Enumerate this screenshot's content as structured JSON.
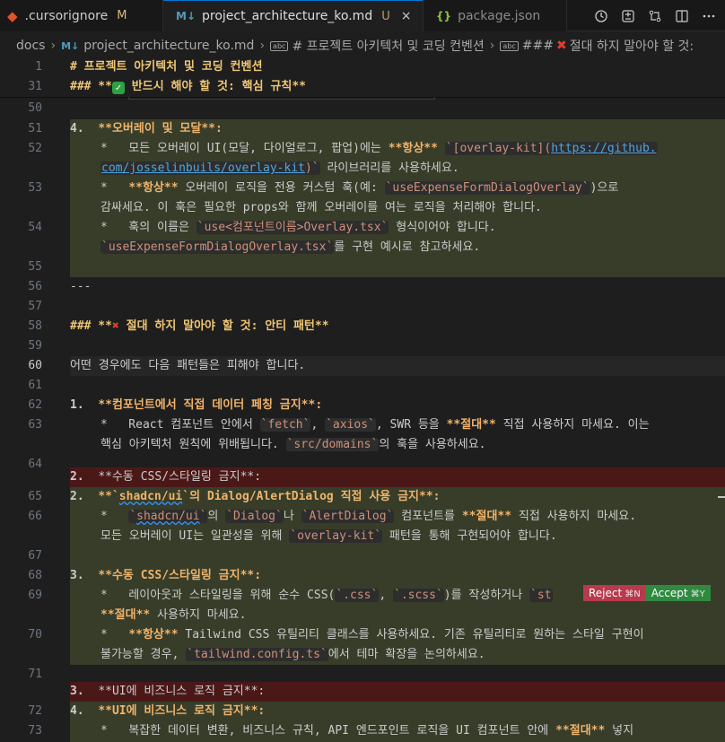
{
  "tabs": [
    {
      "label": ".cursorignore",
      "mark": "M",
      "icon": "git-icon"
    },
    {
      "label": "project_architecture_ko.md",
      "mark": "U",
      "icon": "markdown-icon",
      "close": "×"
    },
    {
      "label": "package.json",
      "icon": "json-icon"
    }
  ],
  "tab_icons": {
    "md": "M↓",
    "json": "{}",
    "git": "◆"
  },
  "breadcrumb": {
    "folder": "docs",
    "file": "project_architecture_ko.md",
    "section1": "# 프로젝트 아키텍처 및 코딩 컨벤션",
    "section2_prefix": "###",
    "section2_text": "절대 하지 말아야 할 것:",
    "abc": "abc"
  },
  "diff_buttons": {
    "reject": "Reject",
    "reject_kbd": "⌘N",
    "accept": "Accept",
    "accept_kbd": "⌘Y"
  },
  "colors": {
    "added_bg": "#373d29",
    "removed_bg": "#4b1818",
    "accent": "#0078d4"
  },
  "lines": {
    "l1": {
      "n": "1",
      "text": "# 프로젝트 아키텍처 및 코딩 컨벤션"
    },
    "l31": {
      "n": "31",
      "pre": "### **",
      "post": " 반드시 해야 할 것: 핵심 규칙**"
    },
    "l50": {
      "n": "50"
    },
    "l51": {
      "n": "51",
      "num": "4.",
      "text": "**오버레이 및 모달**:"
    },
    "l52": {
      "n": "52",
      "a": "*   모든 오버레이 UI(모달, 다이얼로그, 팝업)에는 ",
      "b": "**항상**",
      "c": "[overlay-kit](",
      "link1": "https://github.",
      "link2": "com/josselinbuils/overlay-kit",
      "d": ")`",
      "e": " 라이브러리를 사용하세요."
    },
    "l53": {
      "n": "53",
      "a": "*   ",
      "b": "**항상**",
      "c": " 오버레이 로직을 전용 커스텀 훅(예: ",
      "d": "`useExpenseFormDialogOverlay`",
      "e": ")으로",
      "f": "감싸세요. 이 훅은 필요한 props와 함께 오버레이를 여는 로직을 처리해야 합니다."
    },
    "l54": {
      "n": "54",
      "a": "*   훅의 이름은 ",
      "b": "`use<컴포넌트이름>Overlay.tsx`",
      "c": " 형식이어야 합니다.",
      "d": "`useExpenseFormDialogOverlay.tsx`",
      "e": "를 구현 예시로 참고하세요."
    },
    "l55": {
      "n": "55"
    },
    "l56": {
      "n": "56",
      "text": "---"
    },
    "l57": {
      "n": "57"
    },
    "l58": {
      "n": "58",
      "pre": "### **",
      "post": " 절대 하지 말아야 할 것: 안티 패턴**"
    },
    "l59": {
      "n": "59"
    },
    "l60": {
      "n": "60",
      "text": "어떤 경우에도 다음 패턴들은 피해야 합니다."
    },
    "l61": {
      "n": "61"
    },
    "l62": {
      "n": "62",
      "num": "1.",
      "text": "**컴포넌트에서 직접 데이터 페칭 금지**:"
    },
    "l63": {
      "n": "63",
      "a": "*   React 컴포넌트 안에서 ",
      "b": "`fetch`",
      "c": ", ",
      "d": "`axios`",
      "e": ", SWR 등을 ",
      "f": "**절대**",
      "g": " 직접 사용하지 마세요. 이는",
      "h": "핵심 아키텍처 원칙에 위배됩니다. ",
      "i": "`src/domains`",
      "j": "의 훅을 사용하세요."
    },
    "l64": {
      "n": "64"
    },
    "del2": {
      "num": "2.",
      "text": "**수동 CSS/스타일링 금지**:"
    },
    "l65": {
      "n": "65",
      "num": "2.",
      "a": "**`",
      "b": "shadcn/ui",
      "c": "`의 Dialog/AlertDialog 직접 사용 금지**:"
    },
    "l66": {
      "n": "66",
      "a": "*   ",
      "b": "`",
      "c": "shadcn/ui",
      "d": "`",
      "e": "의 ",
      "f": "`Dialog`",
      "g": "나 ",
      "h": "`AlertDialog`",
      "i": " 컴포넌트를 ",
      "j": "**절대**",
      "k": " 직접 사용하지 마세요.",
      "l": "모든 오버레이 UI는 일관성을 위해 ",
      "m": "`overlay-kit`",
      "n2": " 패턴을 통해 구현되어야 합니다."
    },
    "l67": {
      "n": "67"
    },
    "l68": {
      "n": "68",
      "num": "3.",
      "text": "**수동 CSS/스타일링 금지**:"
    },
    "l69": {
      "n": "69",
      "a": "*   레이아웃과 스타일링을 위해 순수 CSS(",
      "b": "`.css`",
      "c": ", ",
      "d": "`.scss`",
      "e": ")를 작성하거나 ",
      "f": "`st",
      "g": "**절대**",
      "h": " 사용하지 마세요."
    },
    "l70": {
      "n": "70",
      "a": "*   ",
      "b": "**항상**",
      "c": " Tailwind CSS 유틸리티 클래스를 사용하세요. 기존 유틸리티로 원하는 스타일 구현이",
      "d": "불가능할 경우, ",
      "e": "`tailwind.config.ts`",
      "f": "에서 테마 확장을 논의하세요."
    },
    "l71": {
      "n": "71"
    },
    "del3": {
      "num": "3.",
      "text": "**UI에 비즈니스 로직 금지**:"
    },
    "l72": {
      "n": "72",
      "num": "4.",
      "text": "**UI에 비즈니스 로직 금지**:"
    },
    "l73": {
      "n": "73",
      "a": "*   복잡한 데이터 변환, 비즈니스 규칙, API 엔드포인트 로직을 UI 컴포넌트 안에 ",
      "b": "**절대**",
      "c": " 넣지"
    }
  }
}
